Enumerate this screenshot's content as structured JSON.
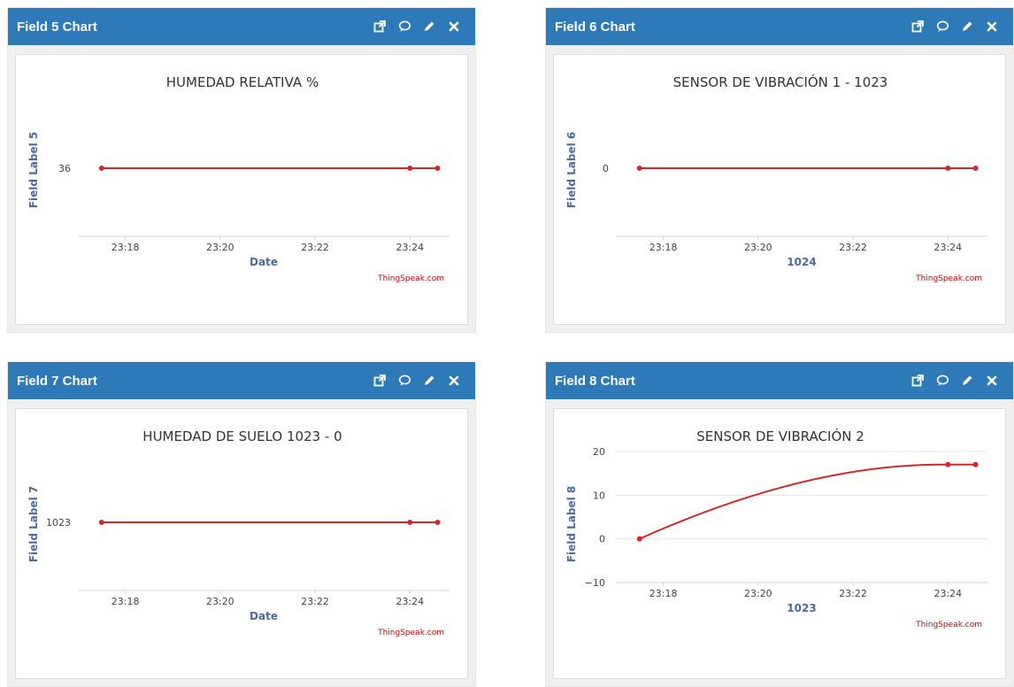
{
  "panels": [
    {
      "header": "Field 5 Chart",
      "icons": [
        "external-link-icon",
        "comment-icon",
        "pencil-icon",
        "close-icon"
      ],
      "credit": "ThingSpeak.com",
      "chart_data": {
        "type": "line",
        "title": "HUMEDAD RELATIVA %",
        "xlabel": "Date",
        "ylabel": "Field Label 5",
        "x_ticks": [
          "23:18",
          "23:20",
          "23:22",
          "23:24"
        ],
        "y_ticks": [
          "36"
        ],
        "series": [
          {
            "x": [
              "23:17:30",
              "23:24:00",
              "23:24:35"
            ],
            "values": [
              36,
              36,
              36
            ]
          }
        ],
        "color": "#d62728",
        "grid": false
      }
    },
    {
      "header": "Field 6 Chart",
      "icons": [
        "external-link-icon",
        "comment-icon",
        "pencil-icon",
        "close-icon"
      ],
      "credit": "ThingSpeak.com",
      "chart_data": {
        "type": "line",
        "title": "SENSOR DE VIBRACIÓN 1 - 1023",
        "xlabel": "1024",
        "ylabel": "Field Label 6",
        "x_ticks": [
          "23:18",
          "23:20",
          "23:22",
          "23:24"
        ],
        "y_ticks": [
          "0"
        ],
        "series": [
          {
            "x": [
              "23:17:30",
              "23:24:00",
              "23:24:35"
            ],
            "values": [
              0,
              0,
              0
            ]
          }
        ],
        "color": "#d62728",
        "grid": false
      }
    },
    {
      "header": "Field 7 Chart",
      "icons": [
        "external-link-icon",
        "comment-icon",
        "pencil-icon",
        "close-icon"
      ],
      "credit": "ThingSpeak.com",
      "chart_data": {
        "type": "line",
        "title": "HUMEDAD DE SUELO 1023 - 0",
        "xlabel": "Date",
        "ylabel": "Field Label 7",
        "x_ticks": [
          "23:18",
          "23:20",
          "23:22",
          "23:24"
        ],
        "y_ticks": [
          "1023"
        ],
        "series": [
          {
            "x": [
              "23:17:30",
              "23:24:00",
              "23:24:35"
            ],
            "values": [
              1023,
              1023,
              1023
            ]
          }
        ],
        "color": "#d62728",
        "grid": false
      }
    },
    {
      "header": "Field 8 Chart",
      "icons": [
        "external-link-icon",
        "comment-icon",
        "pencil-icon",
        "close-icon"
      ],
      "credit": "ThingSpeak.com",
      "chart_data": {
        "type": "line",
        "title": "SENSOR DE VIBRACIÓN 2",
        "xlabel": "1023",
        "ylabel": "Field Label 8",
        "x_ticks": [
          "23:18",
          "23:20",
          "23:22",
          "23:24"
        ],
        "y_ticks": [
          "20",
          "10",
          "0",
          "−10"
        ],
        "ylim": [
          -10,
          20
        ],
        "series": [
          {
            "x": [
              "23:17:30",
              "23:24:00",
              "23:24:35"
            ],
            "values": [
              0,
              17,
              17
            ]
          }
        ],
        "color": "#d62728",
        "grid": true
      }
    }
  ]
}
